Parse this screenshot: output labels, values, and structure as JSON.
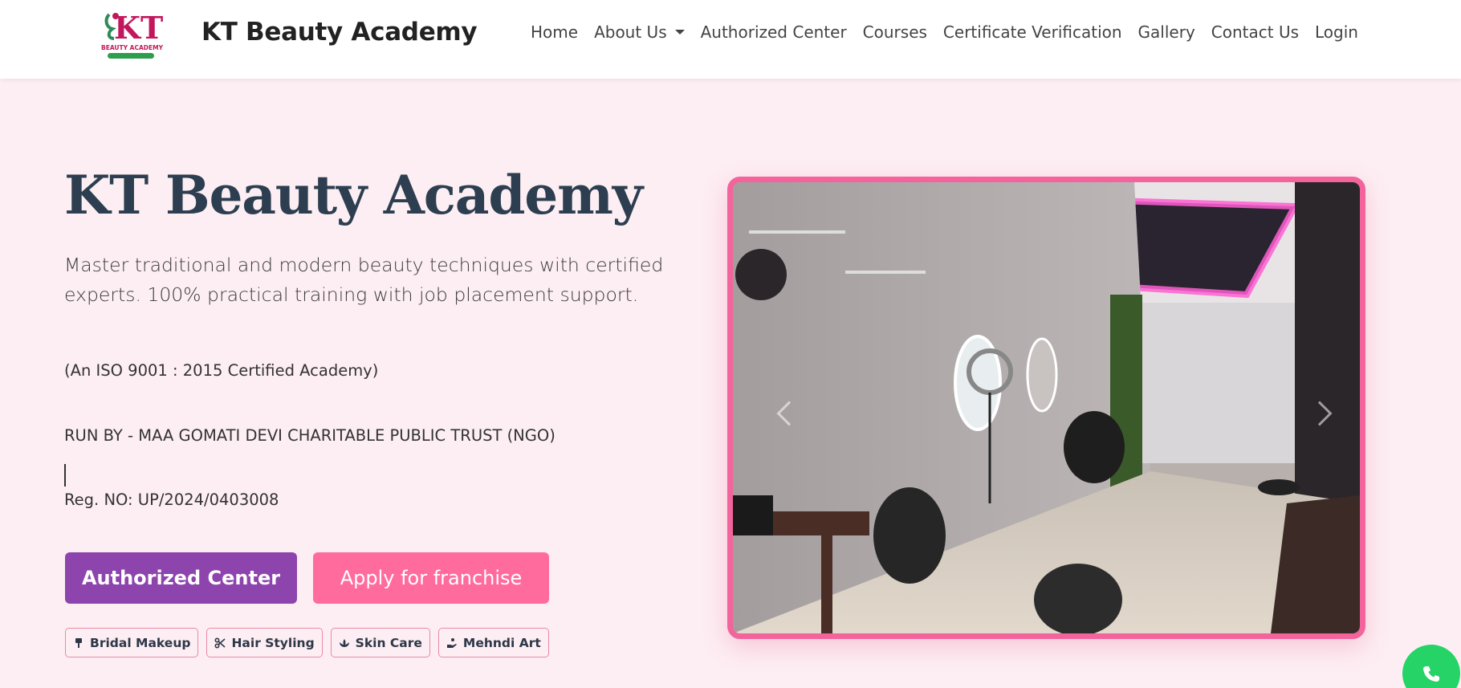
{
  "navbar": {
    "brand": "KT Beauty Academy",
    "logo_text_top": "KT",
    "logo_text_bottom": "BEAUTY ACADEMY",
    "items": [
      {
        "label": "Home"
      },
      {
        "label": "About Us",
        "dropdown": true
      },
      {
        "label": "Authorized Center"
      },
      {
        "label": "Courses"
      },
      {
        "label": "Certificate Verification"
      },
      {
        "label": "Gallery"
      },
      {
        "label": "Contact Us"
      },
      {
        "label": "Login"
      }
    ]
  },
  "hero": {
    "title": "KT Beauty Academy",
    "subtitle": "Master traditional and modern beauty techniques with certified experts. 100% practical training with job placement support.",
    "iso": "(An ISO 9001 : 2015 Certified Academy)",
    "run_by": "RUN BY - MAA GOMATI DEVI CHARITABLE PUBLIC TRUST (NGO)",
    "reg_no": "Reg. NO: UP/2024/0403008",
    "buttons": {
      "authorized_center": "Authorized Center",
      "apply_franchise": "Apply for franchise"
    },
    "tags": [
      {
        "label": "Bridal Makeup",
        "icon": "brush-icon"
      },
      {
        "label": "Hair Styling",
        "icon": "scissors-icon"
      },
      {
        "label": "Skin Care",
        "icon": "spa-icon"
      },
      {
        "label": "Mehndi Art",
        "icon": "hand-icon"
      }
    ]
  },
  "colors": {
    "background": "#fdeef3",
    "primary_button": "#8e44ad",
    "pink_button": "#ff6b9d",
    "image_border": "#f2649b",
    "whatsapp": "#25d366"
  }
}
